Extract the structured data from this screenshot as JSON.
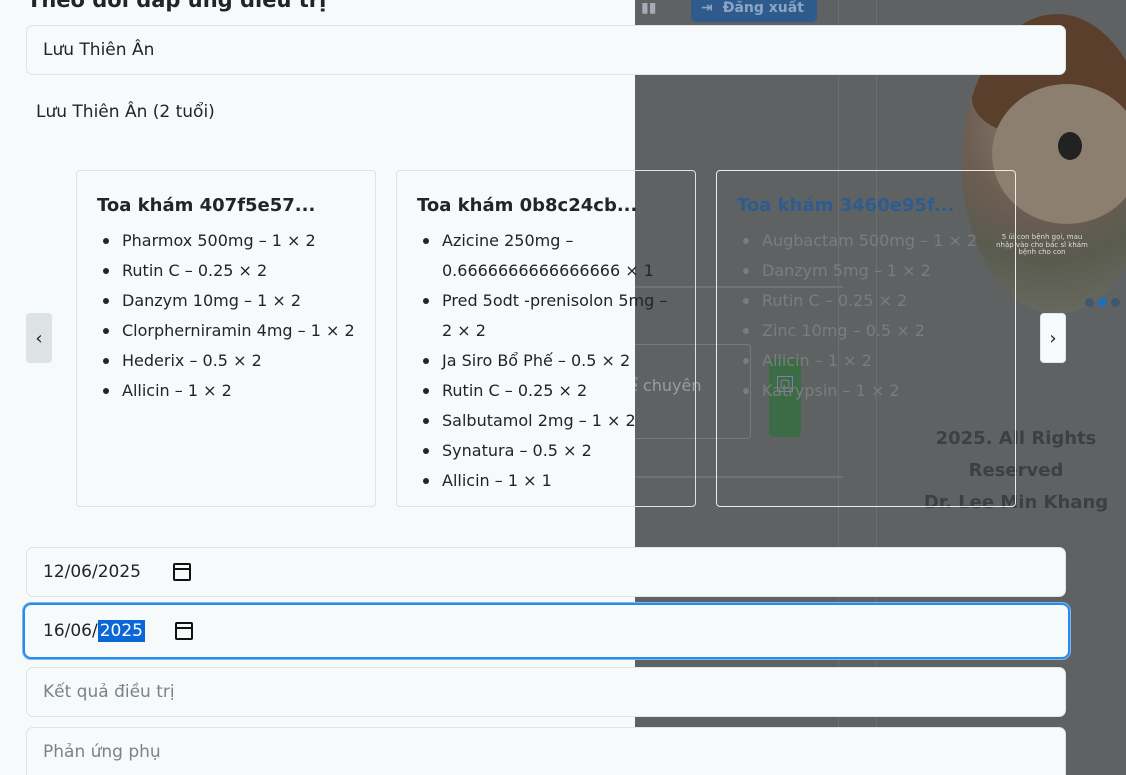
{
  "page": {
    "heading": "Theo dõi đáp ứng điều trị",
    "patient_field_value": "Lưu Thiên Ân",
    "patient_line": "Lưu Thiên Ân (2 tuổi)"
  },
  "carousel": {
    "prev_label": "‹",
    "next_label": "›",
    "cards": [
      {
        "title": "Toa khám 407f5e57...",
        "items": [
          "Pharmox 500mg – 1 × 2",
          "Rutin C – 0.25 × 2",
          "Danzym 10mg – 1 × 2",
          "Clorpherniramin 4mg – 1 × 2",
          "Hederix – 0.5 × 2",
          "Allicin – 1 × 2"
        ]
      },
      {
        "title": "Toa khám 0b8c24cb...",
        "items": [
          "Azicine 250mg – 0.6666666666666666 × 1",
          "Pred 5odt -prenisolon 5mg – 2 × 2",
          "Ja Siro Bổ Phế – 0.5 × 2",
          "Rutin C – 0.25 × 2",
          "Salbutamol 2mg – 1 × 2",
          "Synatura – 0.5 × 2",
          "Allicin – 1 × 1"
        ]
      },
      {
        "title": "Toa khám 3460e95f...",
        "items": [
          "Augbactam 500mg – 1 × 2",
          "Danzym 5mg – 1 × 2",
          "Rutin C – 0.25 × 2",
          "Zinc 10mg – 0.5 × 2",
          "Allicin – 1 × 2",
          "Katrypsin – 1 × 2"
        ]
      }
    ]
  },
  "form": {
    "start_date": "12/06/2025",
    "end_date_day_month": "16/06/",
    "end_date_year_selected": "2025",
    "result_placeholder": "Kết quả điều trị",
    "side_effect_placeholder": "Phản ứng phụ"
  },
  "background": {
    "logout_label": "Đăng xuất",
    "textarea_text": "ể chuyên",
    "copyright_line1": "2025. All Rights Reserved",
    "copyright_line2": "Dr. Lee Min Khang",
    "avatar_caption": "5 ủi con bệnh gọi, mau nhập vào cho bác sĩ khám bệnh cho con"
  }
}
